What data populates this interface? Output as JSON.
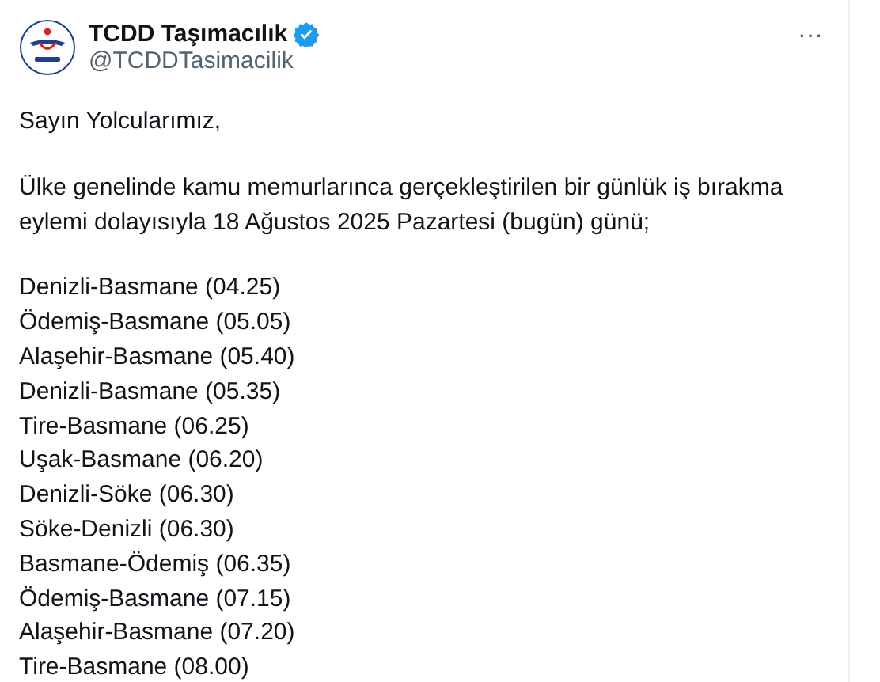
{
  "author": {
    "name": "TCDD Taşımacılık",
    "handle": "@TCDDTasimacilik",
    "verified": true
  },
  "more": "···",
  "paragraphs": [
    "Sayın Yolcularımız,",
    "Ülke genelinde kamu memurlarınca gerçekleştirilen bir günlük iş bırakma eylemi dolayısıyla 18 Ağustos 2025 Pazartesi (bugün) günü;"
  ],
  "trains": [
    "Denizli-Basmane (04.25)",
    "Ödemiş-Basmane (05.05)",
    "Alaşehir-Basmane (05.40)",
    "Denizli-Basmane (05.35)",
    "Tire-Basmane (06.25)",
    "Uşak-Basmane (06.20)",
    "Denizli-Söke (06.30)",
    "Söke-Denizli (06.30)",
    "Basmane-Ödemiş (06.35)",
    "Ödemiş-Basmane (07.15)",
    "Alaşehir-Basmane (07.20)",
    "Tire-Basmane (08.00)"
  ]
}
